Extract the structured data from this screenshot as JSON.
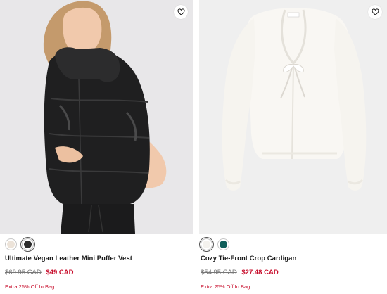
{
  "products": [
    {
      "name": "Ultimate Vegan Leather Mini Puffer Vest",
      "original_price": "$69.95 CAD",
      "sale_price": "$49 CAD",
      "promo": "Extra 25% Off In Bag",
      "image_icon": "product-photo-puffer-vest",
      "swatches": [
        {
          "color": "#ece3d9",
          "selected": false
        },
        {
          "color": "#2c2c2c",
          "selected": true
        }
      ]
    },
    {
      "name": "Cozy Tie-Front Crop Cardigan",
      "original_price": "$54.95 CAD",
      "sale_price": "$27.48 CAD",
      "promo": "Extra 25% Off In Bag",
      "image_icon": "product-photo-cardigan",
      "swatches": [
        {
          "color": "#f4f2ee",
          "selected": true
        },
        {
          "color": "#0f5e5a",
          "selected": false
        }
      ]
    }
  ],
  "colors": {
    "sale": "#c8102e",
    "original": "#777777"
  },
  "icons": {
    "wishlist": "heart-icon"
  }
}
